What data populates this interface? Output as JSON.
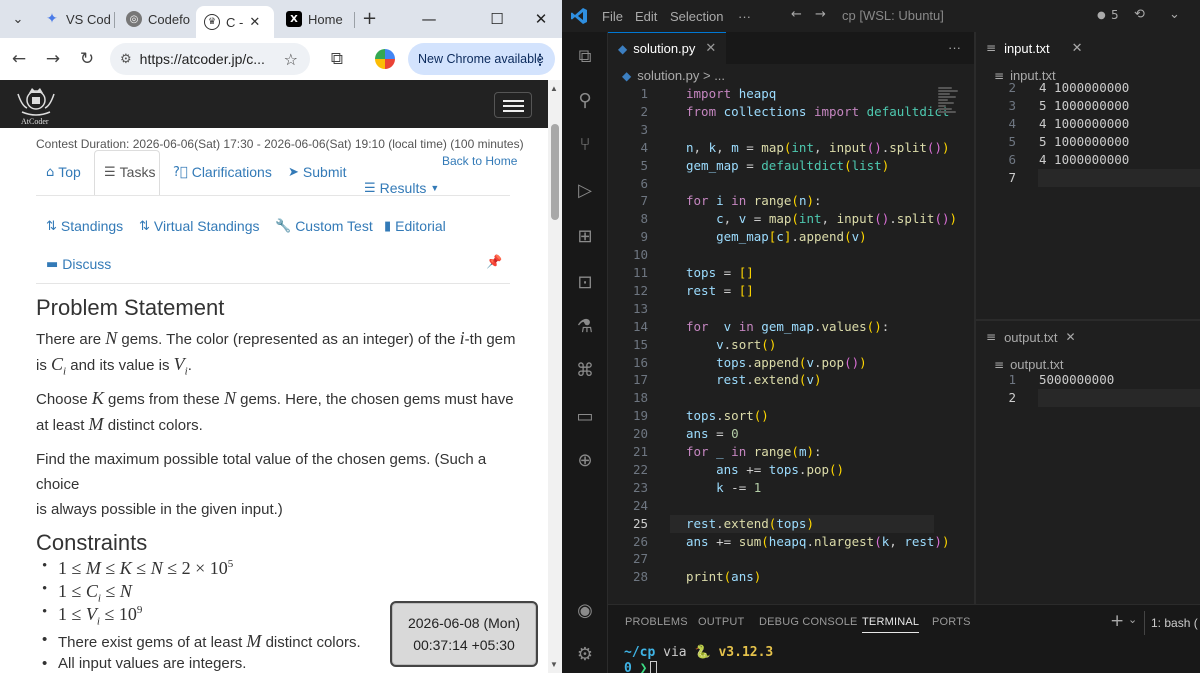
{
  "chrome": {
    "tabs": [
      {
        "title": "VS Cod",
        "icon": "gemini-sparkle-icon",
        "active": false
      },
      {
        "title": "Codefo",
        "icon": "codeforces-icon",
        "active": false
      },
      {
        "title": "C -",
        "icon": "atcoder-icon",
        "active": true
      },
      {
        "title": "Home",
        "icon": "x-icon",
        "active": false
      }
    ],
    "new_tab": "+",
    "address": "https://atcoder.jp/c...",
    "update_button": "New Chrome available"
  },
  "atcoder": {
    "logo_text": "AtCoder",
    "contest_duration": "Contest Duration: 2026-06-06(Sat) 17:30 - 2026-06-06(Sat) 19:10 (local time) (100 minutes)",
    "back_to_home": "Back to Home",
    "nav": {
      "top": "Top",
      "tasks": "Tasks",
      "clarifications": "Clarifications",
      "submit": "Submit",
      "results": "Results",
      "standings": "Standings",
      "virtual_standings": "Virtual Standings",
      "custom_test": "Custom Test",
      "editorial": "Editorial",
      "discuss": "Discuss"
    },
    "problem_heading": "Problem Statement",
    "p1a": "There are ",
    "p1b": " gems. The color (represented as an integer) of the ",
    "p1c": "-th gem",
    "p1d": "is ",
    "p1e": " and its value is ",
    "p1f": ".",
    "p2a": "Choose ",
    "p2b": " gems from these ",
    "p2c": " gems. Here, the chosen gems must have",
    "p2d": "at least ",
    "p2e": " distinct colors.",
    "p3a": "Find the maximum possible total value of the chosen gems. (Such a choice",
    "p3b": "is always possible in the given input.)",
    "constraints_heading": "Constraints",
    "c4a": "There exist gems of at least ",
    "c4b": " distinct colors.",
    "c5": "All input values are integers."
  },
  "clock": {
    "date": "2026-06-08 (Mon)",
    "time": "00:37:14 +05:30"
  },
  "vscode": {
    "menus": [
      "File",
      "Edit",
      "Selection",
      "···"
    ],
    "search": "cp [WSL: Ubuntu]",
    "badge_count": "5",
    "editor_tab": "solution.py",
    "breadcrumb": "solution.py > ...",
    "code": [
      "import heapq",
      "from collections import defaultdict",
      "",
      "n, k, m = map(int, input().split())",
      "gem_map = defaultdict(list)",
      "",
      "for i in range(n):",
      "    c, v = map(int, input().split())",
      "    gem_map[c].append(v)",
      "",
      "tops = []",
      "rest = []",
      "",
      "for  v in gem_map.values():",
      "    v.sort()",
      "    tops.append(v.pop())",
      "    rest.extend(v)",
      "",
      "tops.sort()",
      "ans = 0",
      "for _ in range(m):",
      "    ans += tops.pop()",
      "    k -= 1",
      "",
      "rest.extend(tops)",
      "ans += sum(heapq.nlargest(k, rest))",
      "",
      "print(ans)"
    ],
    "current_line": 25,
    "input_tab": "input.txt",
    "input_breadcrumb": "input.txt",
    "input_lines": [
      {
        "n": "2",
        "t": "4 1000000000"
      },
      {
        "n": "3",
        "t": "5 1000000000"
      },
      {
        "n": "4",
        "t": "4 1000000000"
      },
      {
        "n": "5",
        "t": "5 1000000000"
      },
      {
        "n": "6",
        "t": "4 1000000000"
      },
      {
        "n": "7",
        "t": ""
      }
    ],
    "output_tab": "output.txt",
    "output_breadcrumb": "output.txt",
    "output_lines": [
      {
        "n": "1",
        "t": "5000000000"
      },
      {
        "n": "2",
        "t": ""
      }
    ],
    "panel_tabs": [
      "PROBLEMS",
      "OUTPUT",
      "DEBUG CONSOLE",
      "TERMINAL",
      "PORTS"
    ],
    "terminal_selector": "1: bash (",
    "prompt_path": "~/cp",
    "prompt_via": "via",
    "prompt_python": "v3.12.3",
    "prompt_arrow": "❯"
  }
}
